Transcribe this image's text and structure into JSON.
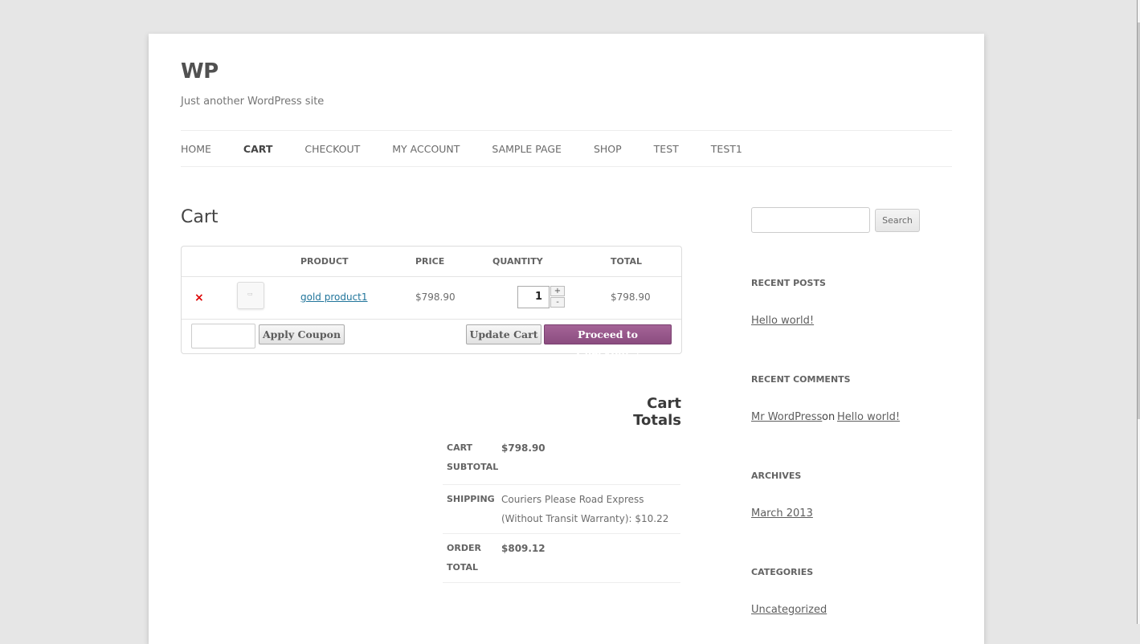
{
  "site": {
    "title": "WP",
    "description": "Just another WordPress site"
  },
  "nav": {
    "items": [
      "HOME",
      "CART",
      "CHECKOUT",
      "MY ACCOUNT",
      "SAMPLE PAGE",
      "SHOP",
      "TEST",
      "TEST1"
    ],
    "active": "CART"
  },
  "page": {
    "title": "Cart"
  },
  "cart": {
    "headers": {
      "product": "PRODUCT",
      "price": "PRICE",
      "quantity": "QUANTITY",
      "total": "TOTAL"
    },
    "items": [
      {
        "remove_icon": "×",
        "product": "gold product1",
        "price": "$798.90",
        "quantity": "1",
        "total": "$798.90"
      }
    ],
    "qty_plus": "+",
    "qty_minus": "-",
    "apply_coupon_label": "Apply Coupon",
    "update_cart_label": "Update Cart",
    "checkout_label": "Proceed to Checkout",
    "checkout_arrow": "›"
  },
  "totals": {
    "title": "Cart Totals",
    "subtotal_label": "CART SUBTOTAL",
    "subtotal_value": "$798.90",
    "shipping_label": "SHIPPING",
    "shipping_value": "Couriers Please Road Express (Without Transit Warranty): $10.22",
    "order_total_label": "ORDER TOTAL",
    "order_total_value": "$809.12"
  },
  "sidebar": {
    "search_button": "Search",
    "recent_posts_title": "RECENT POSTS",
    "recent_posts": [
      "Hello world!"
    ],
    "recent_comments_title": "RECENT COMMENTS",
    "recent_comment": {
      "author": "Mr WordPress",
      "on": "on",
      "post": "Hello world!"
    },
    "archives_title": "ARCHIVES",
    "archives": [
      "March 2013"
    ],
    "categories_title": "CATEGORIES",
    "categories": [
      "Uncategorized"
    ]
  },
  "colors": {
    "background": "#e6e6e6",
    "link": "#21759b",
    "checkout_button": "#a46497",
    "remove": "#dd0000"
  }
}
